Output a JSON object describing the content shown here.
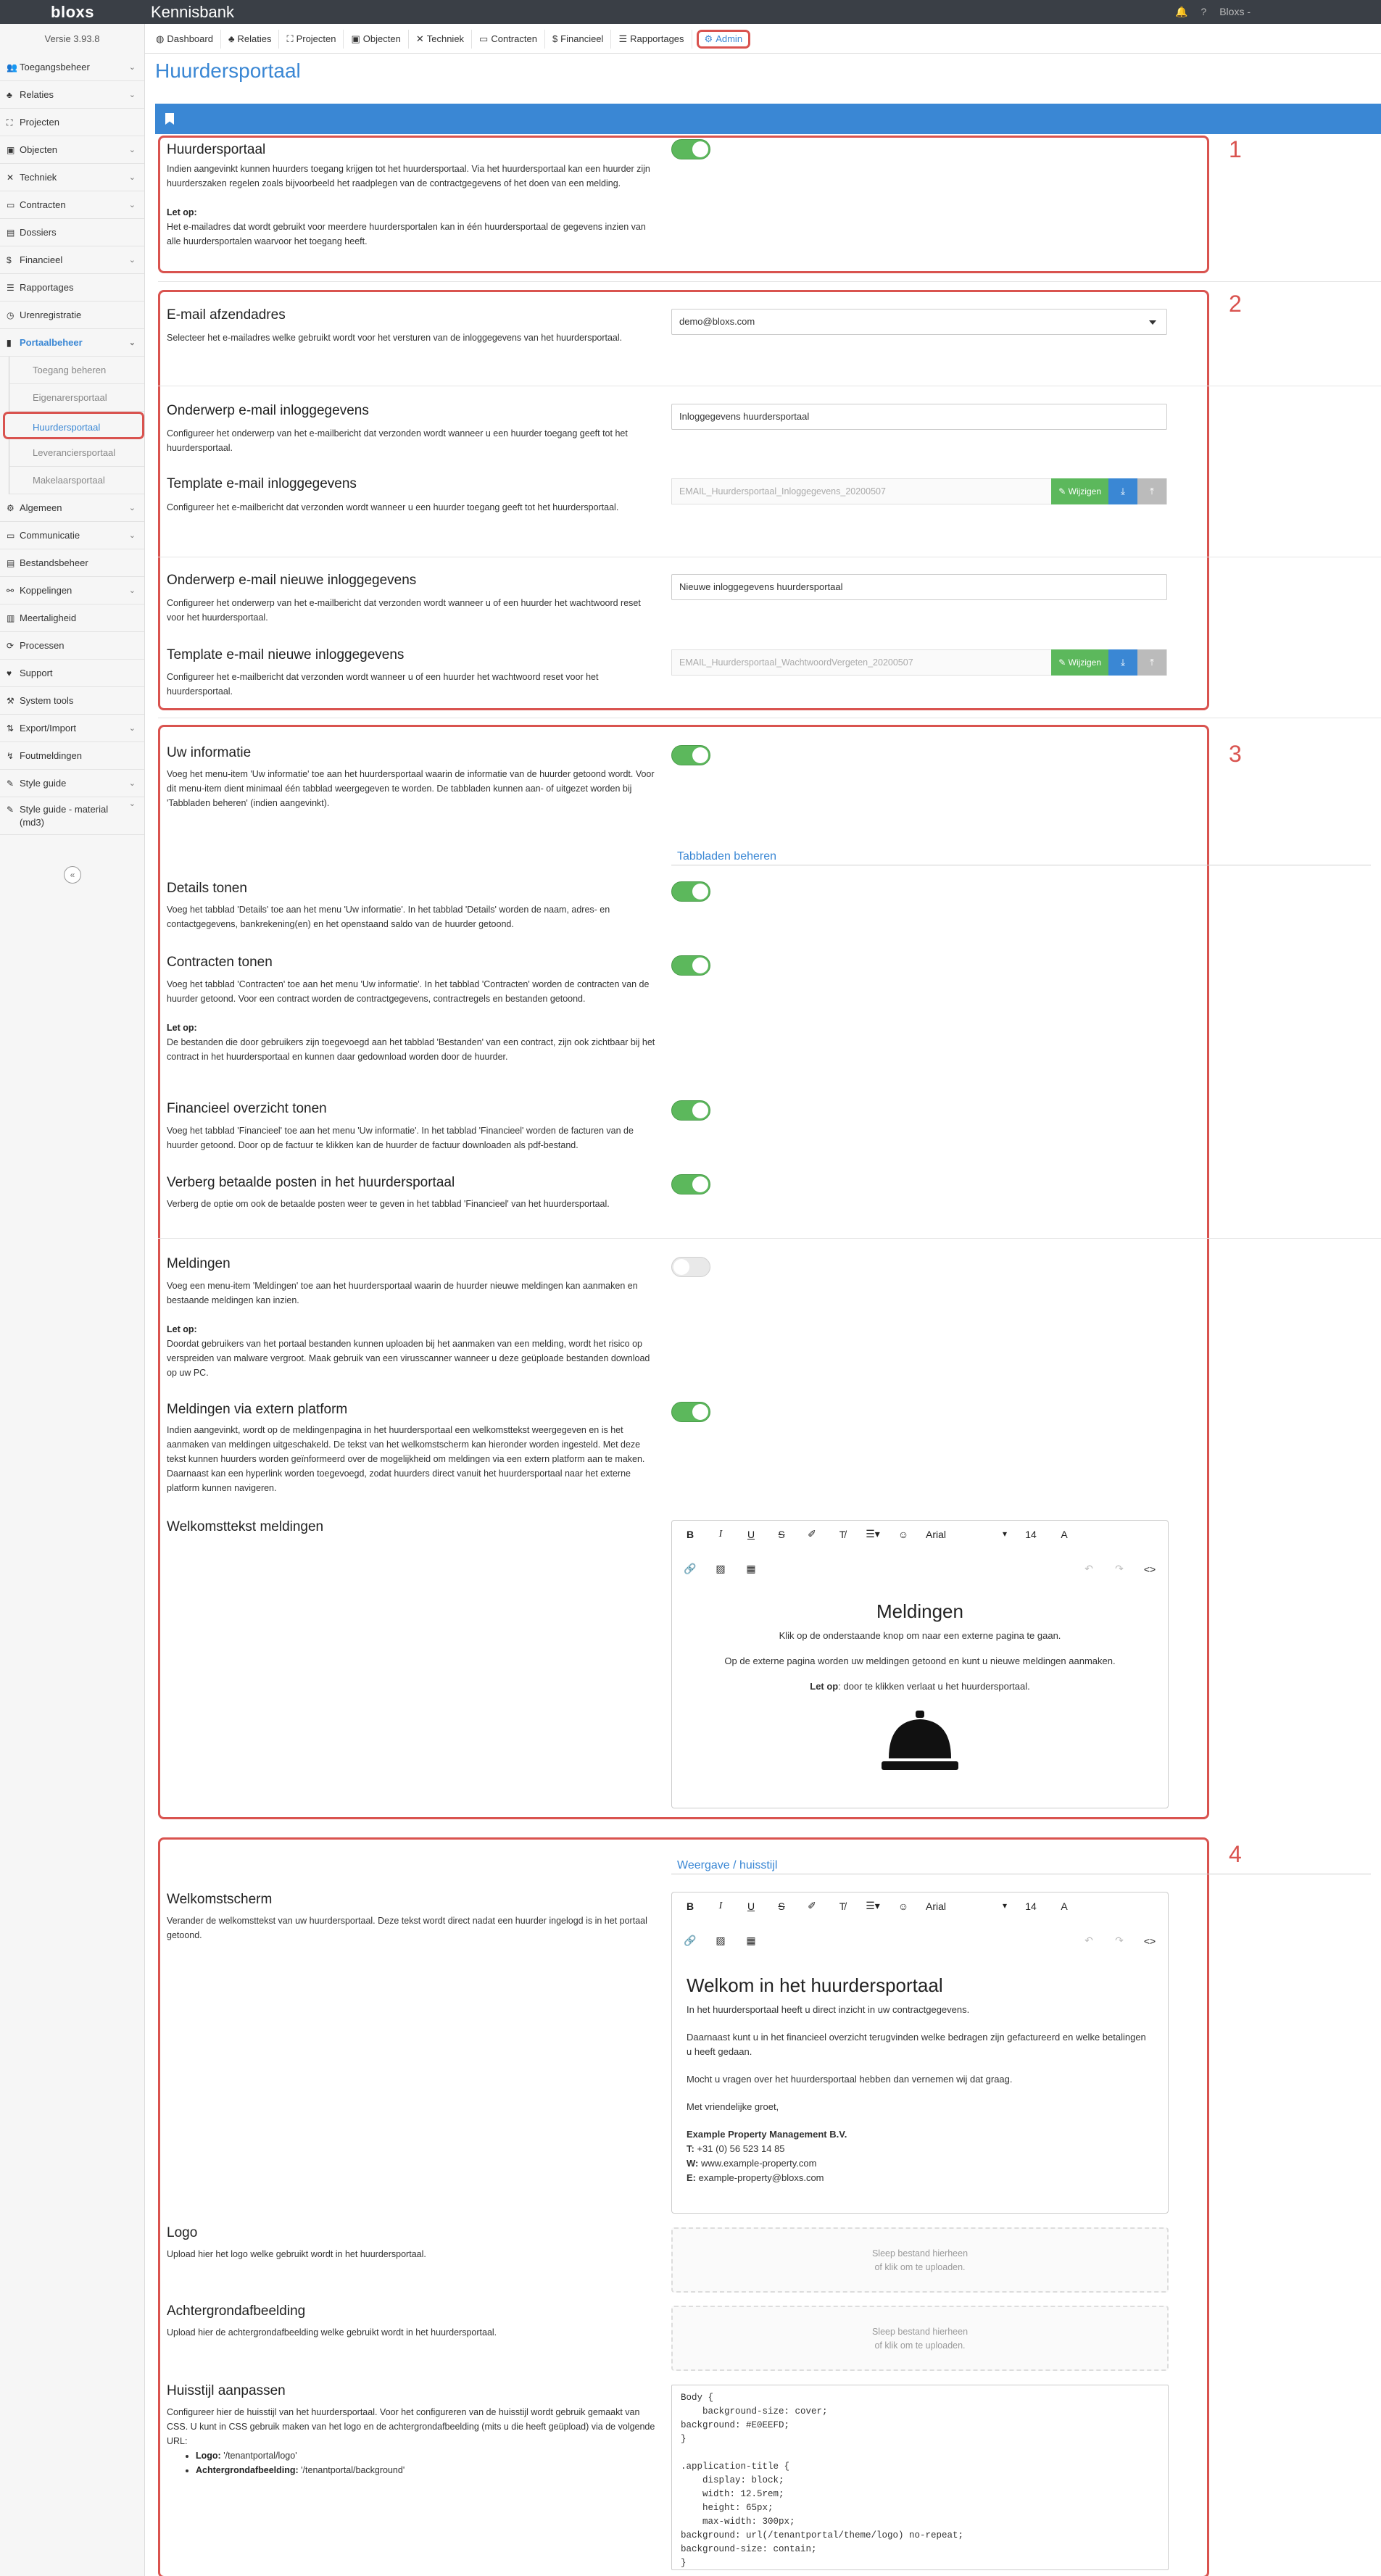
{
  "app": {
    "logo": "bloxs",
    "title": "Kennisbank",
    "user": "Bloxs -",
    "version": "Versie 3.93.8"
  },
  "nav": [
    {
      "icon": "◍",
      "label": "Dashboard"
    },
    {
      "icon": "♣",
      "label": "Relaties"
    },
    {
      "icon": "⛶",
      "label": "Projecten"
    },
    {
      "icon": "▣",
      "label": "Objecten"
    },
    {
      "icon": "✕",
      "label": "Techniek"
    },
    {
      "icon": "▭",
      "label": "Contracten"
    },
    {
      "icon": "$",
      "label": "Financieel"
    },
    {
      "icon": "☰",
      "label": "Rapportages"
    },
    {
      "icon": "⚙",
      "label": "Admin"
    }
  ],
  "sidebar": {
    "top": [
      {
        "icon": "👥",
        "label": "Toegangsbeheer",
        "chev": true
      },
      {
        "icon": "♣",
        "label": "Relaties",
        "chev": true
      },
      {
        "icon": "⛶",
        "label": "Projecten",
        "chev": false
      },
      {
        "icon": "▣",
        "label": "Objecten",
        "chev": true
      },
      {
        "icon": "✕",
        "label": "Techniek",
        "chev": true
      },
      {
        "icon": "▭",
        "label": "Contracten",
        "chev": true
      },
      {
        "icon": "▤",
        "label": "Dossiers",
        "chev": false
      },
      {
        "icon": "$",
        "label": "Financieel",
        "chev": true
      },
      {
        "icon": "☰",
        "label": "Rapportages",
        "chev": false
      },
      {
        "icon": "◷",
        "label": "Urenregistratie",
        "chev": false
      },
      {
        "icon": "▮",
        "label": "Portaalbeheer",
        "chev": true
      }
    ],
    "sub": [
      "Toegang beheren",
      "Eigenarersportaal",
      "Huurdersportaal",
      "Leveranciersportaal",
      "Makelaarsportaal"
    ],
    "bottom": [
      {
        "icon": "⚙",
        "label": "Algemeen",
        "chev": true
      },
      {
        "icon": "▭",
        "label": "Communicatie",
        "chev": true
      },
      {
        "icon": "▤",
        "label": "Bestandsbeheer",
        "chev": false
      },
      {
        "icon": "⚯",
        "label": "Koppelingen",
        "chev": true
      },
      {
        "icon": "▥",
        "label": "Meertaligheid",
        "chev": false
      },
      {
        "icon": "⟳",
        "label": "Processen",
        "chev": false
      },
      {
        "icon": "♥",
        "label": "Support",
        "chev": false
      },
      {
        "icon": "⚒",
        "label": "System tools",
        "chev": false
      },
      {
        "icon": "⇅",
        "label": "Export/Import",
        "chev": true
      },
      {
        "icon": "↯",
        "label": "Foutmeldingen",
        "chev": false
      },
      {
        "icon": "✎",
        "label": "Style guide",
        "chev": true
      },
      {
        "icon": "✎",
        "label": "Style guide - material (md3)",
        "chev": true
      }
    ]
  },
  "page": {
    "title": "Huurdersportaal"
  },
  "markers": [
    "1",
    "2",
    "3",
    "4"
  ],
  "s1": {
    "label": "Huurdersportaal",
    "desc": "Indien aangevinkt kunnen huurders toegang krijgen tot het huurdersportaal. Via het huurdersportaal kan een huurder zijn huurderszaken regelen zoals bijvoorbeeld het raadplegen van de contractgegevens of het doen van een melding.",
    "note_title": "Let op:",
    "note": "Het e-mailadres dat wordt gebruikt voor meerdere huurdersportalen kan in één huurdersportaal de gegevens inzien van alle huurdersportalen waarvoor het toegang heeft."
  },
  "s2": {
    "email_label": "E-mail afzendadres",
    "email_desc": "Selecteer het e-mailadres welke gebruikt wordt voor het versturen van de inloggegevens van het huurdersportaal.",
    "email_value": "demo@bloxs.com",
    "subj1_label": "Onderwerp e-mail inloggegevens",
    "subj1_desc": "Configureer het onderwerp van het e-mailbericht dat verzonden wordt wanneer u een huurder toegang geeft tot het huurdersportaal.",
    "subj1_value": "Inloggegevens huurdersportaal",
    "tpl1_label": "Template e-mail inloggegevens",
    "tpl1_desc": "Configureer het e-mailbericht dat verzonden wordt wanneer u een huurder toegang geeft tot het huurdersportaal.",
    "tpl1_value": "EMAIL_Huurdersportaal_Inloggegevens_20200507",
    "subj2_label": "Onderwerp e-mail nieuwe inloggegevens",
    "subj2_desc": "Configureer het onderwerp van het e-mailbericht dat verzonden wordt wanneer u of een huurder het wachtwoord reset voor het huurdersportaal.",
    "subj2_value": "Nieuwe inloggegevens huurdersportaal",
    "tpl2_label": "Template e-mail nieuwe inloggegevens",
    "tpl2_desc": "Configureer het e-mailbericht dat verzonden wordt wanneer u of een huurder het wachtwoord reset voor het huurdersportaal.",
    "tpl2_value": "EMAIL_Huurdersportaal_WachtwoordVergeten_20200507",
    "edit_label": "Wijzigen"
  },
  "s3": {
    "info_label": "Uw informatie",
    "info_desc": "Voeg het menu-item 'Uw informatie' toe aan het huurdersportaal waarin de informatie van de huurder getoond wordt. Voor dit menu-item dient minimaal één tabblad weergegeven te worden. De tabbladen kunnen aan- of uitgezet worden bij 'Tabbladen beheren' (indien aangevinkt).",
    "tabs_heading": "Tabbladen beheren",
    "details_label": "Details tonen",
    "details_desc": "Voeg het tabblad 'Details' toe aan het menu 'Uw informatie'. In het tabblad 'Details' worden de naam, adres- en contactgegevens, bankrekening(en) en het openstaand saldo van de huurder getoond.",
    "contracts_label": "Contracten tonen",
    "contracts_desc": "Voeg het tabblad 'Contracten' toe aan het menu 'Uw informatie'. In het tabblad 'Contracten' worden de contracten van de huurder getoond. Voor een contract worden de contractgegevens, contractregels en bestanden getoond.",
    "contracts_note_title": "Let op:",
    "contracts_note": "De bestanden die door gebruikers zijn toegevoegd aan het tabblad 'Bestanden' van een contract, zijn ook zichtbaar bij het contract in het huurdersportaal en kunnen daar gedownload worden door de huurder.",
    "fin_label": "Financieel overzicht tonen",
    "fin_desc": "Voeg het tabblad 'Financieel' toe aan het menu 'Uw informatie'. In het tabblad 'Financieel' worden de facturen van de huurder getoond. Door op de factuur te klikken kan de huurder de factuur downloaden als pdf-bestand.",
    "hide_label": "Verberg betaalde posten in het huurdersportaal",
    "hide_desc": "Verberg de optie om ook de betaalde posten weer te geven in het tabblad 'Financieel' van het huurdersportaal.",
    "meld_label": "Meldingen",
    "meld_desc": "Voeg een menu-item 'Meldingen' toe aan het huurdersportaal waarin de huurder nieuwe meldingen kan aanmaken en bestaande meldingen kan inzien.",
    "meld_note_title": "Let op:",
    "meld_note": "Doordat gebruikers van het portaal bestanden kunnen uploaden bij het aanmaken van een melding, wordt het risico op verspreiden van malware vergroot. Maak gebruik van een virusscanner wanneer u deze geüploade bestanden download op uw PC.",
    "ext_label": "Meldingen via extern platform",
    "ext_desc": "Indien aangevinkt, wordt op de meldingenpagina in het huurdersportaal een welkomsttekst weergegeven en is het aanmaken van meldingen uitgeschakeld. De tekst van het welkomstscherm kan hieronder worden ingesteld. Met deze tekst kunnen huurders worden geïnformeerd over de mogelijkheid om meldingen via een extern platform aan te maken. Daarnaast kan een hyperlink worden toegevoegd, zodat huurders direct vanuit het huurdersportaal naar het externe platform kunnen navigeren.",
    "welcome_label": "Welkomsttekst meldingen",
    "editor": {
      "font": "Arial",
      "size": "14",
      "heading": "Meldingen",
      "p1": "Klik op de onderstaande knop om naar een externe pagina te gaan.",
      "p2": "Op de externe pagina worden uw meldingen getoond en kunt u nieuwe meldingen aanmaken.",
      "p3_bold": "Let op",
      "p3": ": door te klikken verlaat u het huurdersportaal."
    }
  },
  "s4": {
    "heading": "Weergave / huisstijl",
    "welcome_label": "Welkomstscherm",
    "welcome_desc": "Verander de welkomsttekst van uw huurdersportaal. Deze tekst wordt direct nadat een huurder ingelogd is in het portaal getoond.",
    "editor": {
      "font": "Arial",
      "size": "14",
      "heading": "Welkom in het huurdersportaal",
      "p1": "In het huurdersportaal heeft u direct inzicht in uw contractgegevens.",
      "p2": "Daarnaast kunt u in het financieel overzicht terugvinden welke bedragen zijn gefactureerd en welke betalingen u heeft gedaan.",
      "p3": "Mocht u vragen over het huurdersportaal hebben dan vernemen wij dat graag.",
      "p4": "Met vriendelijke groet,",
      "company": "Example Property Management B.V.",
      "t_label": "T:",
      "t": "+31 (0) 56 523 14 85",
      "w_label": "W:",
      "w": "www.example-property.com",
      "e_label": "E:",
      "e": "example-property@bloxs.com"
    },
    "logo_label": "Logo",
    "logo_desc": "Upload hier het logo welke gebruikt wordt in het huurdersportaal.",
    "bg_label": "Achtergrondafbeelding",
    "bg_desc": "Upload hier de achtergrondafbeelding welke gebruikt wordt in het huurdersportaal.",
    "upload_l1": "Sleep bestand hierheen",
    "upload_l2": "of klik om te uploaden.",
    "css_label": "Huisstijl aanpassen",
    "css_desc": "Configureer hier de huisstijl van het huurdersportaal. Voor het configureren van de huisstijl wordt gebruik gemaakt van CSS. U kunt in CSS gebruik maken van het logo en de achtergrondafbeelding (mits u die heeft geüpload) via de volgende URL:",
    "css_logo_label": "Logo:",
    "css_logo_url": "'/tenantportal/logo'",
    "css_bg_label": "Achtergrondafbeelding:",
    "css_bg_url": "'/tenantportal/background'",
    "css_code": "Body {\n    background-size: cover;\nbackground: #E0EEFD;\n}\n\n.application-title {\n    display: block;\n    width: 12.5rem;\n    height: 65px;\n    max-width: 300px;\nbackground: url(/tenantportal/theme/logo) no-repeat;\nbackground-size: contain;\n}"
  }
}
